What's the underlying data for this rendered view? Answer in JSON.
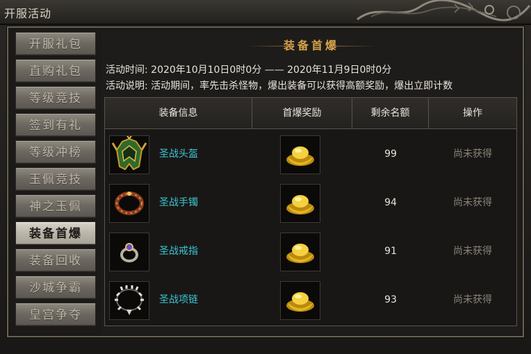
{
  "window": {
    "title": "开服活动"
  },
  "sidebar": {
    "items": [
      {
        "label": "开服礼包",
        "active": false
      },
      {
        "label": "直购礼包",
        "active": false
      },
      {
        "label": "等级竞技",
        "active": false
      },
      {
        "label": "签到有礼",
        "active": false
      },
      {
        "label": "等级冲榜",
        "active": false
      },
      {
        "label": "玉佩竞技",
        "active": false
      },
      {
        "label": "神之玉佩",
        "active": false
      },
      {
        "label": "装备首爆",
        "active": true
      },
      {
        "label": "装备回收",
        "active": false
      },
      {
        "label": "沙城争霸",
        "active": false
      },
      {
        "label": "皇宫争夺",
        "active": false
      }
    ]
  },
  "main": {
    "heading": "装备首爆",
    "time_line": "活动时间: 2020年10月10日0时0分 —— 2020年11月9日0时0分",
    "desc_line": "活动说明: 活动期间，率先击杀怪物，爆出装备可以获得高额奖励，爆出立即计数"
  },
  "table": {
    "headers": [
      "装备信息",
      "首爆奖励",
      "剩余名额",
      "操作"
    ],
    "rows": [
      {
        "icon": "helmet-icon",
        "name": "圣战头盔",
        "reward_icon": "gold-ingot-icon",
        "remaining": "99",
        "status": "尚未获得"
      },
      {
        "icon": "bracelet-icon",
        "name": "圣战手镯",
        "reward_icon": "gold-ingot-icon",
        "remaining": "94",
        "status": "尚未获得"
      },
      {
        "icon": "ring-icon",
        "name": "圣战戒指",
        "reward_icon": "gold-ingot-icon",
        "remaining": "91",
        "status": "尚未获得"
      },
      {
        "icon": "necklace-icon",
        "name": "圣战项链",
        "reward_icon": "gold-ingot-icon",
        "remaining": "93",
        "status": "尚未获得"
      }
    ]
  },
  "colors": {
    "item_name": "#3cc6d2",
    "heading": "#d4a24a",
    "status_disabled": "#8a8478"
  }
}
